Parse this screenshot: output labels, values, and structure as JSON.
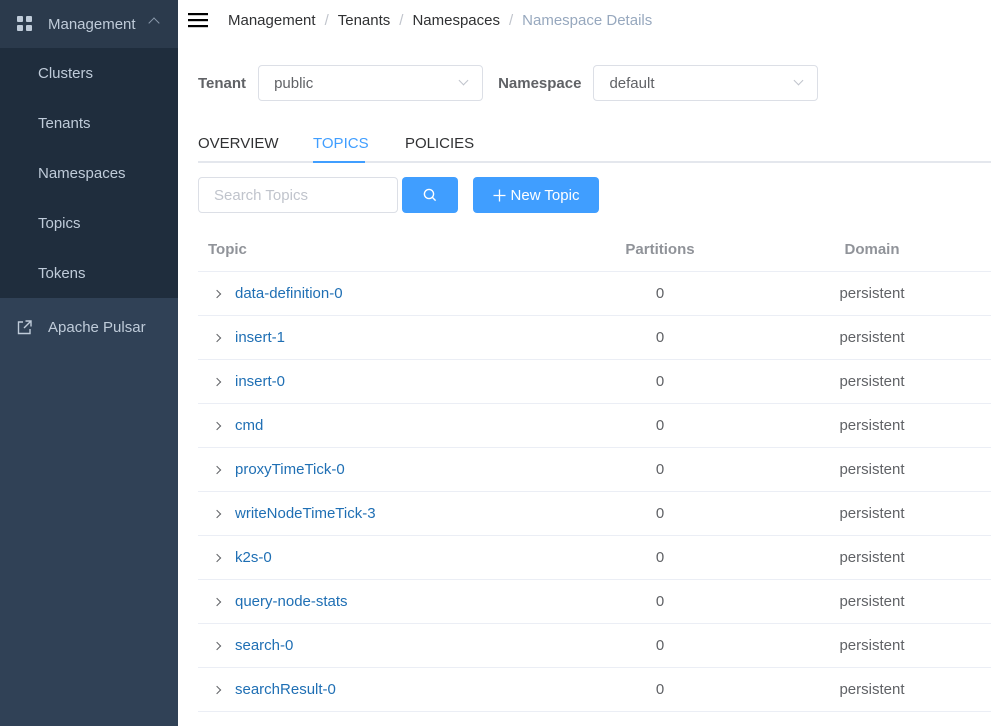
{
  "sidebar": {
    "section_label": "Management",
    "items": [
      {
        "label": "Clusters"
      },
      {
        "label": "Tenants"
      },
      {
        "label": "Namespaces"
      },
      {
        "label": "Topics"
      },
      {
        "label": "Tokens"
      }
    ],
    "external_link": "Apache Pulsar"
  },
  "breadcrumb": [
    "Management",
    "Tenants",
    "Namespaces",
    "Namespace Details"
  ],
  "selectors": {
    "tenant_label": "Tenant",
    "tenant_value": "public",
    "namespace_label": "Namespace",
    "namespace_value": "default"
  },
  "tabs": [
    "OVERVIEW",
    "TOPICS",
    "POLICIES"
  ],
  "active_tab": "TOPICS",
  "search": {
    "placeholder": "Search Topics",
    "new_topic_label": "New Topic"
  },
  "table": {
    "headers": [
      "Topic",
      "Partitions",
      "Domain"
    ],
    "rows": [
      {
        "topic": "data-definition-0",
        "partitions": "0",
        "domain": "persistent"
      },
      {
        "topic": "insert-1",
        "partitions": "0",
        "domain": "persistent"
      },
      {
        "topic": "insert-0",
        "partitions": "0",
        "domain": "persistent"
      },
      {
        "topic": "cmd",
        "partitions": "0",
        "domain": "persistent"
      },
      {
        "topic": "proxyTimeTick-0",
        "partitions": "0",
        "domain": "persistent"
      },
      {
        "topic": "writeNodeTimeTick-3",
        "partitions": "0",
        "domain": "persistent"
      },
      {
        "topic": "k2s-0",
        "partitions": "0",
        "domain": "persistent"
      },
      {
        "topic": "query-node-stats",
        "partitions": "0",
        "domain": "persistent"
      },
      {
        "topic": "search-0",
        "partitions": "0",
        "domain": "persistent"
      },
      {
        "topic": "searchResult-0",
        "partitions": "0",
        "domain": "persistent"
      }
    ]
  },
  "colors": {
    "sidebar_bg": "#304156",
    "submenu_bg": "#1f2d3d",
    "accent": "#409eff",
    "link": "#1f6fb4"
  },
  "icons": {
    "section": "grid-icon",
    "external": "external-link-icon",
    "menu": "hamburger-icon",
    "search": "search-icon",
    "add": "plus-icon",
    "expand": "chevron-right-icon"
  }
}
